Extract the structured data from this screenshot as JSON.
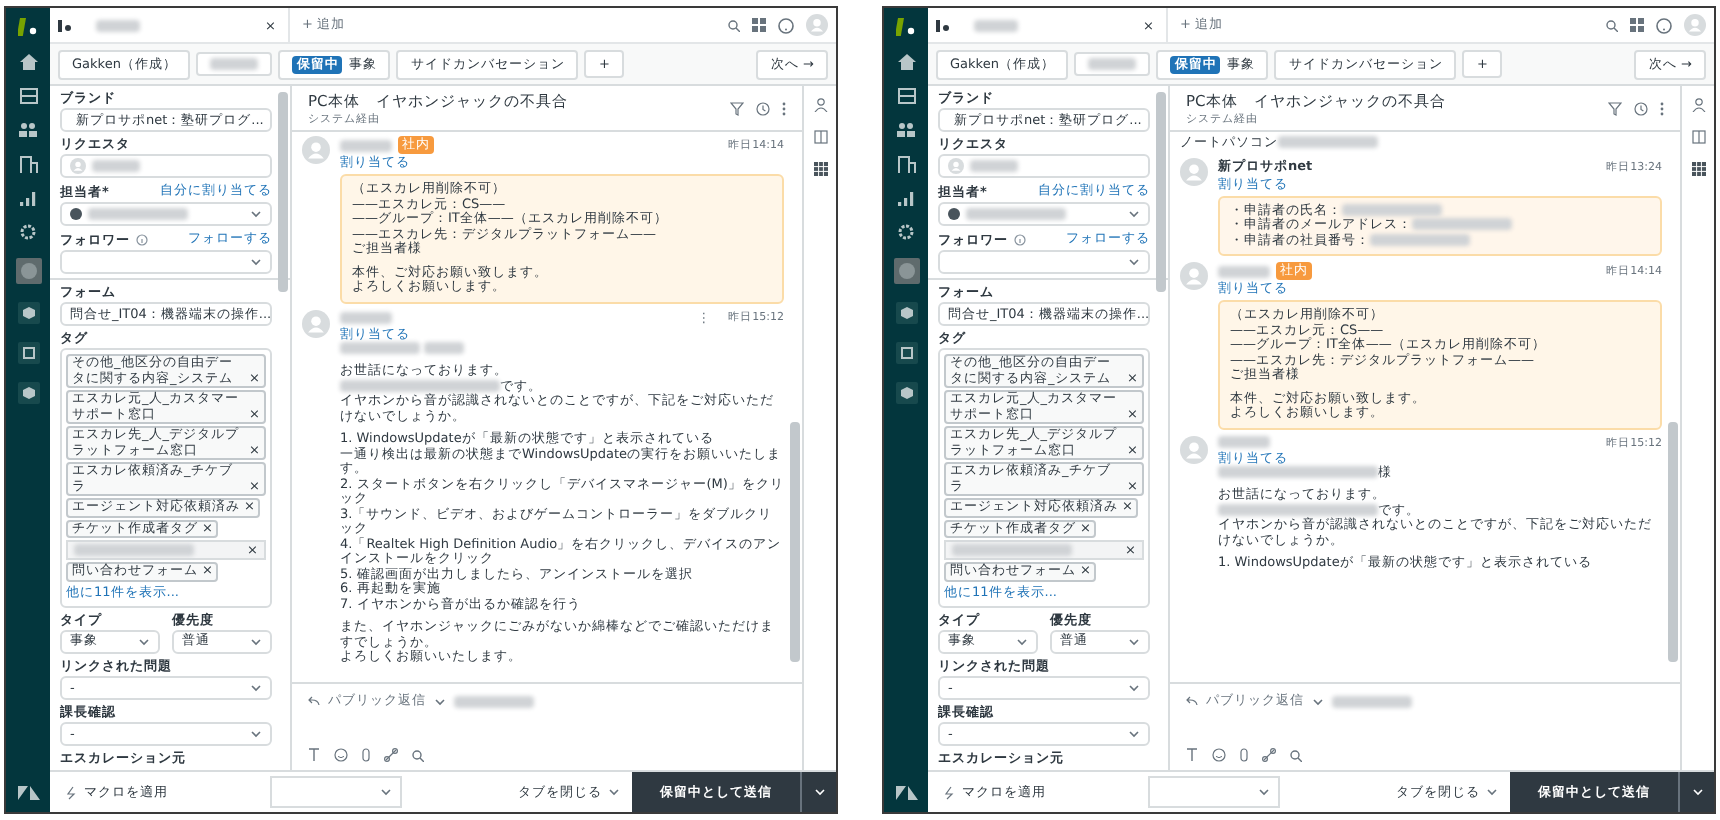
{
  "panels": [
    {
      "top_bar": {
        "tab_close": "×",
        "add_tab": "+ 追加"
      },
      "sub_bar": {
        "requester": "Gakken（作成）",
        "status": "保留中",
        "type": "事象",
        "side_conversation": "サイドカンバセーション",
        "add": "+",
        "next": "次へ →"
      },
      "sidebar": {
        "fields": [
          {
            "kind": "brand_select",
            "label": "ブランド",
            "value": "新プロサポnet：塾研プログ..."
          },
          {
            "kind": "person",
            "label": "リクエスタ"
          },
          {
            "kind": "assignee_select",
            "label": "担当者*",
            "link": "自分に割り当てる"
          },
          {
            "kind": "select",
            "label": "フォロワー",
            "info": true,
            "link": "フォローする"
          },
          {
            "kind": "rule"
          },
          {
            "kind": "select",
            "label": "フォーム",
            "value": "問合せ_IT04：機器端末の操作..."
          },
          {
            "kind": "tags",
            "label": "タグ",
            "tags": [
              {
                "text": "その他_他区分の自由データに関する内容_システム",
                "remove": "×"
              },
              {
                "text": "エスカレ元_人_カスタマーサポート窓口",
                "remove": "×"
              },
              {
                "text": "エスカレ先_人_デジタルプラットフォーム窓口",
                "remove": "×"
              },
              {
                "text": "エスカレ依頼済み_チケブラ",
                "remove": "×"
              },
              {
                "text": "エージェント対応依頼済み",
                "remove": "×"
              },
              {
                "text": "チケット作成者タグ",
                "remove": "×"
              }
            ],
            "input_remove": "×",
            "last_tag": {
              "text": "問い合わせフォーム",
              "remove": "×"
            },
            "more": "他に11件を表示..."
          },
          {
            "kind": "pair",
            "items": [
              {
                "label": "タイプ",
                "value": "事象"
              },
              {
                "label": "優先度",
                "value": "普通"
              }
            ]
          },
          {
            "kind": "select",
            "label": "リンクされた問題",
            "value": "-"
          },
          {
            "kind": "select",
            "label": "課長確認",
            "value": "-"
          },
          {
            "kind": "label",
            "label": "エスカレーション元"
          }
        ]
      },
      "conversation": {
        "title": "PC本体　イヤホンジャックの不具合",
        "channel": "システム経由",
        "messages": [
          {
            "kind": "internal",
            "badge": "社内",
            "time": "昨日14:14",
            "assign": "割り当てる",
            "lines": [
              "（エスカレ用削除不可）",
              "——エスカレ元：CS——",
              "——グループ：IT全体——（エスカレ用削除不可）",
              "——エスカレ先：デジタルプラットフォーム——",
              "ご担当者様",
              {
                "kind": "gap"
              },
              "本件、ご対応お願い致します。",
              "よろしくお願いします。"
            ]
          },
          {
            "kind": "public",
            "time": "昨日15:12",
            "assign": "割り当てる",
            "menu": "⋮",
            "lines": [
              {
                "kind": "redacted"
              },
              {
                "kind": "gap"
              },
              "お世話になっております。",
              {
                "kind": "redacted_prefix",
                "text": "です。"
              },
              "イヤホンから音が認識されないとのことですが、下記をご対応いただけないでしょうか。",
              {
                "kind": "gap"
              },
              "1. WindowsUpdateが「最新の状態です」と表示されている",
              "一通り検出は最新の状態までWindowsUpdateの実行をお願いいたします。",
              "2. スタートボタンを右クリックし「デバイスマネージャー(M)」をクリック",
              "3.「サウンド、ビデオ、およびゲームコントローラー」をダブルクリック",
              "4.「Realtek High Definition Audio」を右クリックし、デバイスのアンインストールをクリック",
              "5. 確認画面が出力しましたら、アンインストールを選択",
              "6. 再起動を実施",
              "7. イヤホンから音が出るか確認を行う",
              {
                "kind": "gap"
              },
              "また、イヤホンジャックにごみがないか綿棒などでご確認いただけますでしょうか。",
              "よろしくお願いいたします。"
            ]
          }
        ]
      },
      "composer": {
        "mode": "パブリック返信"
      },
      "footer": {
        "macro": "マクロを適用",
        "close_tab": "タブを閉じる",
        "submit": "保留中として送信"
      }
    },
    {
      "top_bar": {
        "tab_close": "×",
        "add_tab": "+ 追加"
      },
      "sub_bar": {
        "requester": "Gakken（作成）",
        "status": "保留中",
        "type": "事象",
        "side_conversation": "サイドカンバセーション",
        "add": "+",
        "next": "次へ →"
      },
      "sidebar": {
        "fields": [
          {
            "kind": "brand_select",
            "label": "ブランド",
            "value": "新プロサポnet：塾研プログ..."
          },
          {
            "kind": "person",
            "label": "リクエスタ"
          },
          {
            "kind": "assignee_select",
            "label": "担当者*",
            "link": "自分に割り当てる"
          },
          {
            "kind": "select",
            "label": "フォロワー",
            "info": true,
            "link": "フォローする"
          },
          {
            "kind": "rule"
          },
          {
            "kind": "select",
            "label": "フォーム",
            "value": "問合せ_IT04：機器端末の操作..."
          },
          {
            "kind": "tags",
            "label": "タグ",
            "tags": [
              {
                "text": "その他_他区分の自由データに関する内容_システム",
                "remove": "×"
              },
              {
                "text": "エスカレ元_人_カスタマーサポート窓口",
                "remove": "×"
              },
              {
                "text": "エスカレ先_人_デジタルプラットフォーム窓口",
                "remove": "×"
              },
              {
                "text": "エスカレ依頼済み_チケブラ",
                "remove": "×"
              },
              {
                "text": "エージェント対応依頼済み",
                "remove": "×"
              },
              {
                "text": "チケット作成者タグ",
                "remove": "×"
              }
            ],
            "input_remove": "×",
            "last_tag": {
              "text": "問い合わせフォーム",
              "remove": "×"
            },
            "more": "他に11件を表示..."
          },
          {
            "kind": "pair",
            "items": [
              {
                "label": "タイプ",
                "value": "事象"
              },
              {
                "label": "優先度",
                "value": "普通"
              }
            ]
          },
          {
            "kind": "select",
            "label": "リンクされた問題",
            "value": "-"
          },
          {
            "kind": "select",
            "label": "課長確認",
            "value": "-"
          },
          {
            "kind": "label",
            "label": "エスカレーション元"
          }
        ]
      },
      "conversation": {
        "title": "PC本体　イヤホンジャックの不具合",
        "channel": "システム経由",
        "messages": [
          {
            "kind": "partial",
            "lines": [
              {
                "kind": "redacted_suffix",
                "text": "ノートパソコン"
              }
            ]
          },
          {
            "kind": "public",
            "author": "新プロサポnet",
            "time": "昨日13:24",
            "assign": "割り当てる",
            "boxed": true,
            "lines": [
              {
                "kind": "redacted_suffix",
                "text": "・申請者の氏名："
              },
              {
                "kind": "redacted_suffix",
                "text": "・申請者のメールアドレス："
              },
              {
                "kind": "redacted_suffix",
                "text": "・申請者の社員番号："
              }
            ]
          },
          {
            "kind": "internal",
            "badge": "社内",
            "time": "昨日14:14",
            "assign": "割り当てる",
            "lines": [
              "（エスカレ用削除不可）",
              "——エスカレ元：CS——",
              "——グループ：IT全体——（エスカレ用削除不可）",
              "——エスカレ先：デジタルプラットフォーム——",
              "ご担当者様",
              {
                "kind": "gap"
              },
              "本件、ご対応お願い致します。",
              "よろしくお願いします。"
            ]
          },
          {
            "kind": "public",
            "time": "昨日15:12",
            "assign": "割り当てる",
            "lines": [
              {
                "kind": "redacted_prefix",
                "text": "様"
              },
              {
                "kind": "gap"
              },
              "お世話になっております。",
              {
                "kind": "redacted_prefix",
                "text": "です。"
              },
              "イヤホンから音が認識されないとのことですが、下記をご対応いただけないでしょうか。",
              {
                "kind": "gap"
              },
              "1. WindowsUpdateが「最新の状態です」と表示されている"
            ]
          }
        ]
      },
      "composer": {
        "mode": "パブリック返信"
      },
      "footer": {
        "macro": "マクロを適用",
        "close_tab": "タブを閉じる",
        "submit": "保留中として送信"
      }
    }
  ]
}
